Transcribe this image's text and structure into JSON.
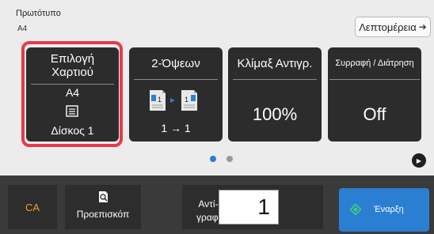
{
  "header": {
    "original_label": "Πρωτότυπο",
    "original_size": "A4",
    "details_label": "Λεπτομέρεια",
    "details_icon": "arrow-right-icon"
  },
  "tiles": {
    "paper": {
      "title_line1": "Επιλογή",
      "title_line2": "Χαρτιού",
      "size": "A4",
      "tray": "Δίσκος 1",
      "selected": true
    },
    "duplex": {
      "title": "2-Όψεων",
      "ratio": "1 → 1"
    },
    "zoom": {
      "title": "Κλίμαξ Αντιγρ.",
      "value": "100%"
    },
    "staple": {
      "title": "Συρραφή / Διάτρηση",
      "value": "Off"
    }
  },
  "pager": {
    "page_count": 2,
    "active_page": 1
  },
  "footer": {
    "ca_label": "CA",
    "preview_label": "Προεπισκόπ",
    "copies_label": "Αντί-γραφα",
    "copies_value": "1",
    "start_label": "Έναρξη"
  },
  "colors": {
    "accent": "#2b7fd2",
    "selection": "#e8394b",
    "ca_text": "#f0a020",
    "start_icon": "#3fd07a"
  }
}
